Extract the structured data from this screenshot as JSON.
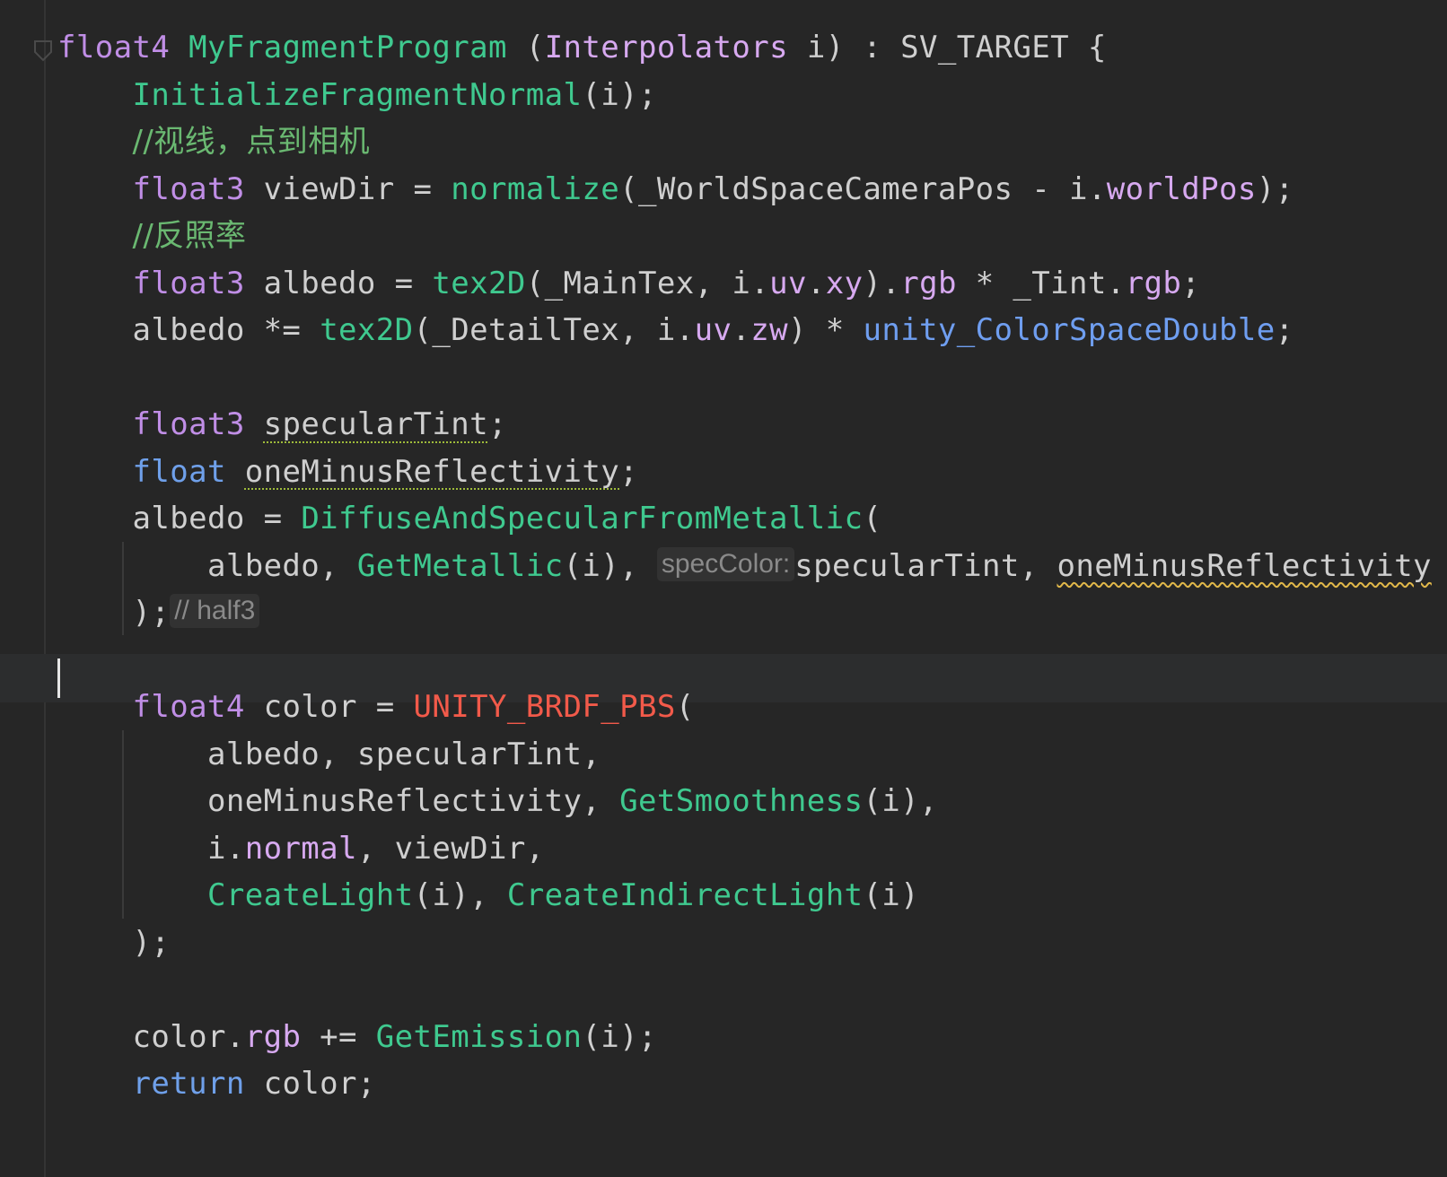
{
  "editor": {
    "lines": [
      {
        "tokens": [
          [
            "kw",
            "float4"
          ],
          [
            "plain",
            " "
          ],
          [
            "fn",
            "MyFragmentProgram"
          ],
          [
            "plain",
            " ("
          ],
          [
            "field",
            "Interpolators"
          ],
          [
            "plain",
            " i) : SV_TARGET {"
          ]
        ]
      },
      {
        "tokens": [
          [
            "plain",
            "    "
          ],
          [
            "fn",
            "InitializeFragmentNormal"
          ],
          [
            "plain",
            "(i);"
          ]
        ]
      },
      {
        "tokens": [
          [
            "plain",
            "    "
          ],
          [
            "comment",
            "//视线，点到相机"
          ]
        ]
      },
      {
        "tokens": [
          [
            "plain",
            "    "
          ],
          [
            "kw",
            "float3"
          ],
          [
            "plain",
            " viewDir = "
          ],
          [
            "fn",
            "normalize"
          ],
          [
            "plain",
            "(_WorldSpaceCameraPos - i."
          ],
          [
            "field",
            "worldPos"
          ],
          [
            "plain",
            ");"
          ]
        ]
      },
      {
        "tokens": [
          [
            "plain",
            "    "
          ],
          [
            "comment",
            "//反照率"
          ]
        ]
      },
      {
        "tokens": [
          [
            "plain",
            "    "
          ],
          [
            "kw",
            "float3"
          ],
          [
            "plain",
            " albedo = "
          ],
          [
            "fn",
            "tex2D"
          ],
          [
            "plain",
            "(_MainTex, i."
          ],
          [
            "field",
            "uv"
          ],
          [
            "plain",
            "."
          ],
          [
            "field",
            "xy"
          ],
          [
            "plain",
            ")."
          ],
          [
            "field",
            "rgb"
          ],
          [
            "plain",
            " * _Tint."
          ],
          [
            "field",
            "rgb"
          ],
          [
            "plain",
            ";"
          ]
        ]
      },
      {
        "tokens": [
          [
            "plain",
            "    albedo *= "
          ],
          [
            "fn",
            "tex2D"
          ],
          [
            "plain",
            "(_DetailTex, i."
          ],
          [
            "field",
            "uv"
          ],
          [
            "plain",
            "."
          ],
          [
            "field",
            "zw"
          ],
          [
            "plain",
            ") * "
          ],
          [
            "gvar",
            "unity_ColorSpaceDouble"
          ],
          [
            "plain",
            ";"
          ]
        ]
      },
      {
        "tokens": []
      },
      {
        "tokens": [
          [
            "plain",
            "    "
          ],
          [
            "kw",
            "float3"
          ],
          [
            "plain",
            " "
          ],
          [
            "plain-dots",
            "specularTint"
          ],
          [
            "plain",
            ";"
          ]
        ]
      },
      {
        "tokens": [
          [
            "plain",
            "    "
          ],
          [
            "kw-blue",
            "float"
          ],
          [
            "plain",
            " "
          ],
          [
            "plain-dots",
            "oneMinusReflectivity"
          ],
          [
            "plain",
            ";"
          ]
        ]
      },
      {
        "tokens": [
          [
            "plain",
            "    albedo = "
          ],
          [
            "fn",
            "DiffuseAndSpecularFromMetallic"
          ],
          [
            "plain",
            "("
          ]
        ]
      },
      {
        "tokens": [
          [
            "plain",
            "        albedo, "
          ],
          [
            "fn",
            "GetMetallic"
          ],
          [
            "plain",
            "(i), "
          ],
          [
            "hint",
            "specColor:"
          ],
          [
            "plain",
            "specularTint, "
          ],
          [
            "plain-wave",
            "oneMinusReflectivity"
          ]
        ]
      },
      {
        "tokens": [
          [
            "plain",
            "    );"
          ],
          [
            "hint",
            "// half3"
          ]
        ]
      },
      {
        "tokens": []
      },
      {
        "tokens": [
          [
            "plain",
            "    "
          ],
          [
            "kw",
            "float4"
          ],
          [
            "plain",
            " color = "
          ],
          [
            "macro",
            "UNITY_BRDF_PBS"
          ],
          [
            "plain",
            "("
          ]
        ]
      },
      {
        "tokens": [
          [
            "plain",
            "        albedo, specularTint,"
          ]
        ]
      },
      {
        "tokens": [
          [
            "plain",
            "        oneMinusReflectivity, "
          ],
          [
            "fn",
            "GetSmoothness"
          ],
          [
            "plain",
            "(i),"
          ]
        ]
      },
      {
        "tokens": [
          [
            "plain",
            "        i."
          ],
          [
            "field",
            "normal"
          ],
          [
            "plain",
            ", viewDir,"
          ]
        ]
      },
      {
        "tokens": [
          [
            "plain",
            "        "
          ],
          [
            "fn",
            "CreateLight"
          ],
          [
            "plain",
            "(i), "
          ],
          [
            "fn",
            "CreateIndirectLight"
          ],
          [
            "plain",
            "(i)"
          ]
        ]
      },
      {
        "tokens": [
          [
            "plain",
            "    );"
          ]
        ]
      },
      {
        "tokens": []
      },
      {
        "tokens": [
          [
            "plain",
            "    color."
          ],
          [
            "field",
            "rgb"
          ],
          [
            "plain",
            " += "
          ],
          [
            "fn",
            "GetEmission"
          ],
          [
            "plain",
            "(i);"
          ]
        ]
      },
      {
        "tokens": [
          [
            "plain",
            "    "
          ],
          [
            "kw-blue",
            "return"
          ],
          [
            "plain",
            " color;"
          ]
        ]
      }
    ],
    "caret_line": 13
  },
  "colors": {
    "background": "#262626",
    "keyword": "#c08ee6",
    "function": "#3fc98f",
    "field": "#d7a9f0",
    "macro": "#f25a4a",
    "global": "#6f9ef0",
    "comment": "#6ab871"
  }
}
